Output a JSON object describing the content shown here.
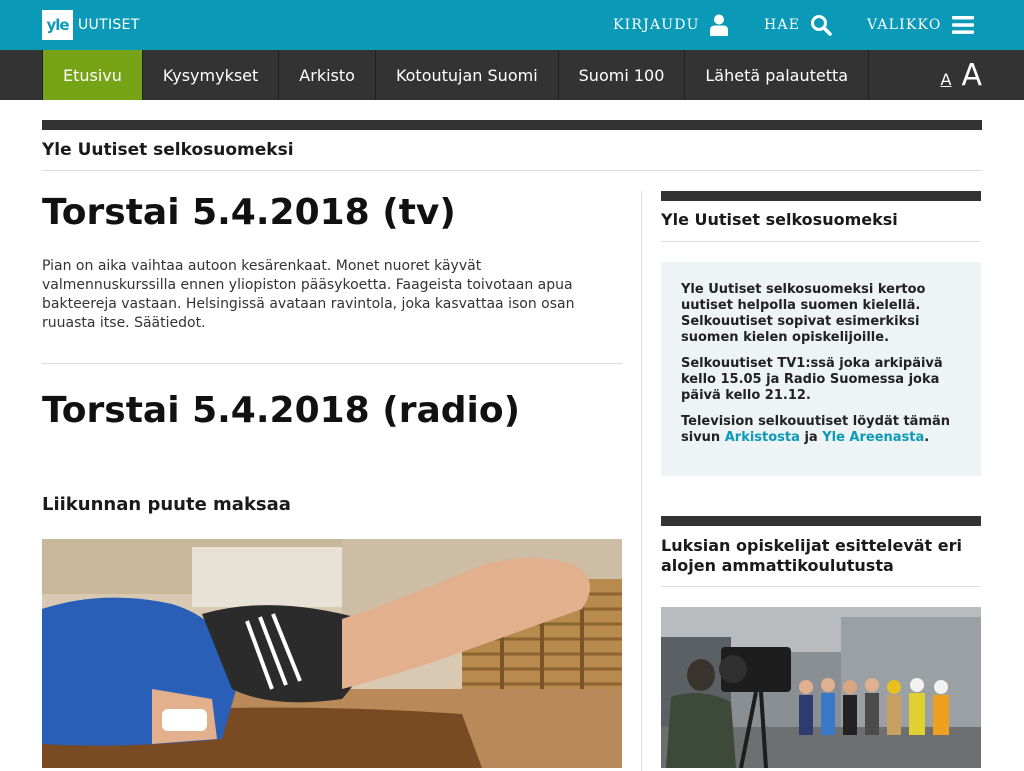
{
  "header": {
    "logo_mark": "yle",
    "logo_text": "UUTISET",
    "login_label": "KIRJAUDU",
    "search_label": "HAE",
    "menu_label": "VALIKKO",
    "bg_color": "#0a9ab8"
  },
  "nav": {
    "items": [
      {
        "label": "Etusivu",
        "active": true
      },
      {
        "label": "Kysymykset"
      },
      {
        "label": "Arkisto"
      },
      {
        "label": "Kotoutujan Suomi"
      },
      {
        "label": "Suomi 100"
      },
      {
        "label": "Lähetä palautetta"
      }
    ],
    "font_small": "A",
    "font_large": "A",
    "active_color": "#77a317"
  },
  "section": {
    "title": "Yle Uutiset selkosuomeksi"
  },
  "main": {
    "article1_title": "Torstai 5.4.2018 (tv)",
    "article1_lead": "Pian on aika vaihtaa autoon kesärenkaat. Monet nuoret käyvät valmennuskurssilla ennen yliopiston pääsykoetta. Faageista toivotaan apua bakteereja vastaan. Helsingissä avataan ravintola, joka kasvattaa ison osan ruuasta itse. Säätiedot.",
    "article2_title": "Torstai 5.4.2018 (radio)",
    "story_title": "Liikunnan puute maksaa"
  },
  "sidebar": {
    "box_title": "Yle Uutiset selkosuomeksi",
    "para1": "Yle Uutiset selkosuomeksi kertoo uutiset helpolla suomen kielellä. Selkouutiset sopivat esimerkiksi suomen kielen opiskelijoille.",
    "para2": "Selkouutiset TV1:ssä joka arkipäivä kello 15.05 ja Radio Suomessa joka päivä kello 21.12.",
    "para3_before": "Television selkouutiset löydät tämän sivun",
    "link_arkisto": "Arkistosta",
    "para3_mid": "ja",
    "link_areena": "Yle Areenasta",
    "para3_after": ".",
    "story_title": "Luksian opiskelijat esittelevät eri alojen ammattikoulutusta"
  }
}
